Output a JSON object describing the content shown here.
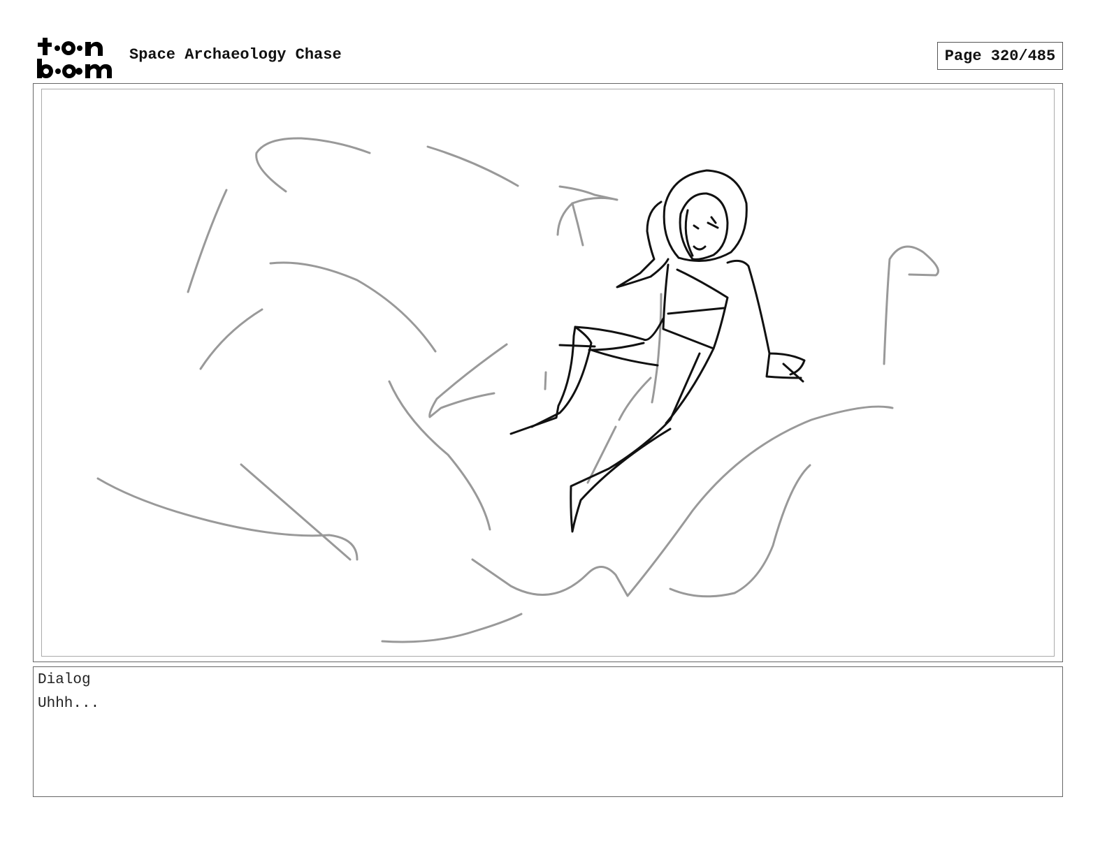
{
  "header": {
    "logo_text": "toon boom",
    "title": "Space Archaeology Chase",
    "page_label": "Page 320/485"
  },
  "panel": {
    "sketch_subject": "astronaut-floating-sketch"
  },
  "dialog": {
    "label": "Dialog",
    "text": "Uhhh..."
  }
}
